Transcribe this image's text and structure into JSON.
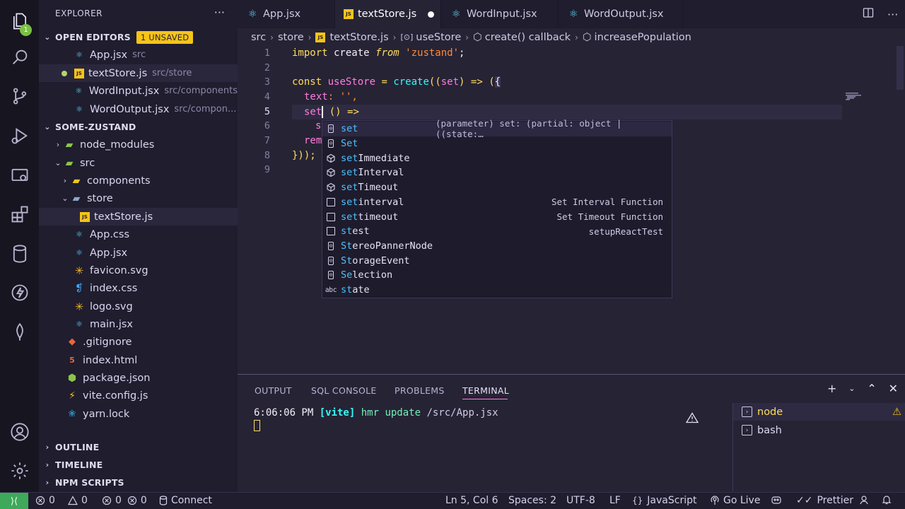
{
  "activity_bar": {
    "explorer_badge": "1"
  },
  "sidebar": {
    "title": "EXPLORER",
    "more": "···",
    "open_editors": {
      "label": "OPEN EDITORS",
      "badge": "1 UNSAVED",
      "items": [
        {
          "name": "App.jsx",
          "desc": "src"
        },
        {
          "name": "textStore.js",
          "desc": "src/store"
        },
        {
          "name": "WordInput.jsx",
          "desc": "src/components"
        },
        {
          "name": "WordOutput.jsx",
          "desc": "src/compon..."
        }
      ]
    },
    "project": {
      "label": "SOME-ZUSTAND",
      "items": [
        {
          "name": "node_modules"
        },
        {
          "name": "src"
        },
        {
          "name": "components"
        },
        {
          "name": "store"
        },
        {
          "name": "textStore.js"
        },
        {
          "name": "App.css"
        },
        {
          "name": "App.jsx"
        },
        {
          "name": "favicon.svg"
        },
        {
          "name": "index.css"
        },
        {
          "name": "logo.svg"
        },
        {
          "name": "main.jsx"
        },
        {
          "name": ".gitignore"
        },
        {
          "name": "index.html"
        },
        {
          "name": "package.json"
        },
        {
          "name": "vite.config.js"
        },
        {
          "name": "yarn.lock"
        }
      ]
    },
    "sections": [
      "OUTLINE",
      "TIMELINE",
      "NPM SCRIPTS"
    ]
  },
  "tabs": [
    {
      "label": "App.jsx"
    },
    {
      "label": "textStore.js"
    },
    {
      "label": "WordInput.jsx"
    },
    {
      "label": "WordOutput.jsx"
    }
  ],
  "breadcrumb": [
    "src",
    "store",
    "textStore.js",
    "useStore",
    "create() callback",
    "increasePopulation"
  ],
  "editor": {
    "line_numbers": [
      "1",
      "2",
      "3",
      "4",
      "5",
      "6",
      "7",
      "8",
      "9"
    ],
    "line1": {
      "kw": "import",
      "id": " create ",
      "from": "from",
      "str": " 'zustand'",
      "end": ";"
    },
    "line3": {
      "kw": "const",
      "id": " useStore ",
      "op": "= ",
      "fn": "create",
      "rest": "((",
      "param": "set",
      "arrow": ") => (",
      "brace": "{"
    },
    "line4": {
      "prop": "text",
      "rest": ": '', "
    },
    "line5": {
      "prop": "set",
      "rest": " () =>"
    },
    "line6": {
      "text": "s"
    },
    "line7": {
      "prop": "rem"
    },
    "line8": {
      "text": "}));"
    }
  },
  "suggest": {
    "items": [
      {
        "icon": "variable",
        "match": "set",
        "rest": "",
        "detail": "(parameter) set: (partial: object | ((state:…"
      },
      {
        "icon": "variable",
        "match": "Set",
        "rest": "",
        "detail": ""
      },
      {
        "icon": "method",
        "match": "set",
        "rest": "Immediate",
        "detail": ""
      },
      {
        "icon": "method",
        "match": "set",
        "rest": "Interval",
        "detail": ""
      },
      {
        "icon": "method",
        "match": "set",
        "rest": "Timeout",
        "detail": ""
      },
      {
        "icon": "snippet",
        "match": "set",
        "rest": "interval",
        "detail": "Set Interval Function"
      },
      {
        "icon": "snippet",
        "match": "set",
        "rest": "timeout",
        "detail": "Set Timeout Function"
      },
      {
        "icon": "snippet",
        "match": "st",
        "rest": "est",
        "detail": "setupReactTest"
      },
      {
        "icon": "variable",
        "match": "St",
        "rest": "ereoPannerNode",
        "detail": ""
      },
      {
        "icon": "variable",
        "match": "St",
        "rest": "orageEvent",
        "detail": ""
      },
      {
        "icon": "variable",
        "match": "Se",
        "rest": "lection",
        "detail": ""
      },
      {
        "icon": "text",
        "match": "st",
        "rest": "ate",
        "detail": ""
      }
    ]
  },
  "panel": {
    "tabs": [
      "OUTPUT",
      "SQL CONSOLE",
      "PROBLEMS",
      "TERMINAL"
    ],
    "terminal_time": "6:06:06 PM ",
    "terminal_tag": "[vite]",
    "terminal_msg": " hmr update ",
    "terminal_path": "/src/App.jsx",
    "terminals": [
      "node",
      "bash"
    ]
  },
  "status": {
    "errors": "0",
    "warnings": "0",
    "info": "0",
    "info2": "0",
    "connect": "Connect",
    "position": "Ln 5, Col 6",
    "spaces": "Spaces: 2",
    "encoding": "UTF-8",
    "eol": "LF",
    "language": "JavaScript",
    "golive": "Go Live",
    "prettier": "Prettier"
  },
  "colors": {
    "accent": "#ff7edb",
    "keyword": "#fede5d",
    "function": "#36f9f6",
    "string": "#ff8b39",
    "remote": "#3fa95b"
  }
}
